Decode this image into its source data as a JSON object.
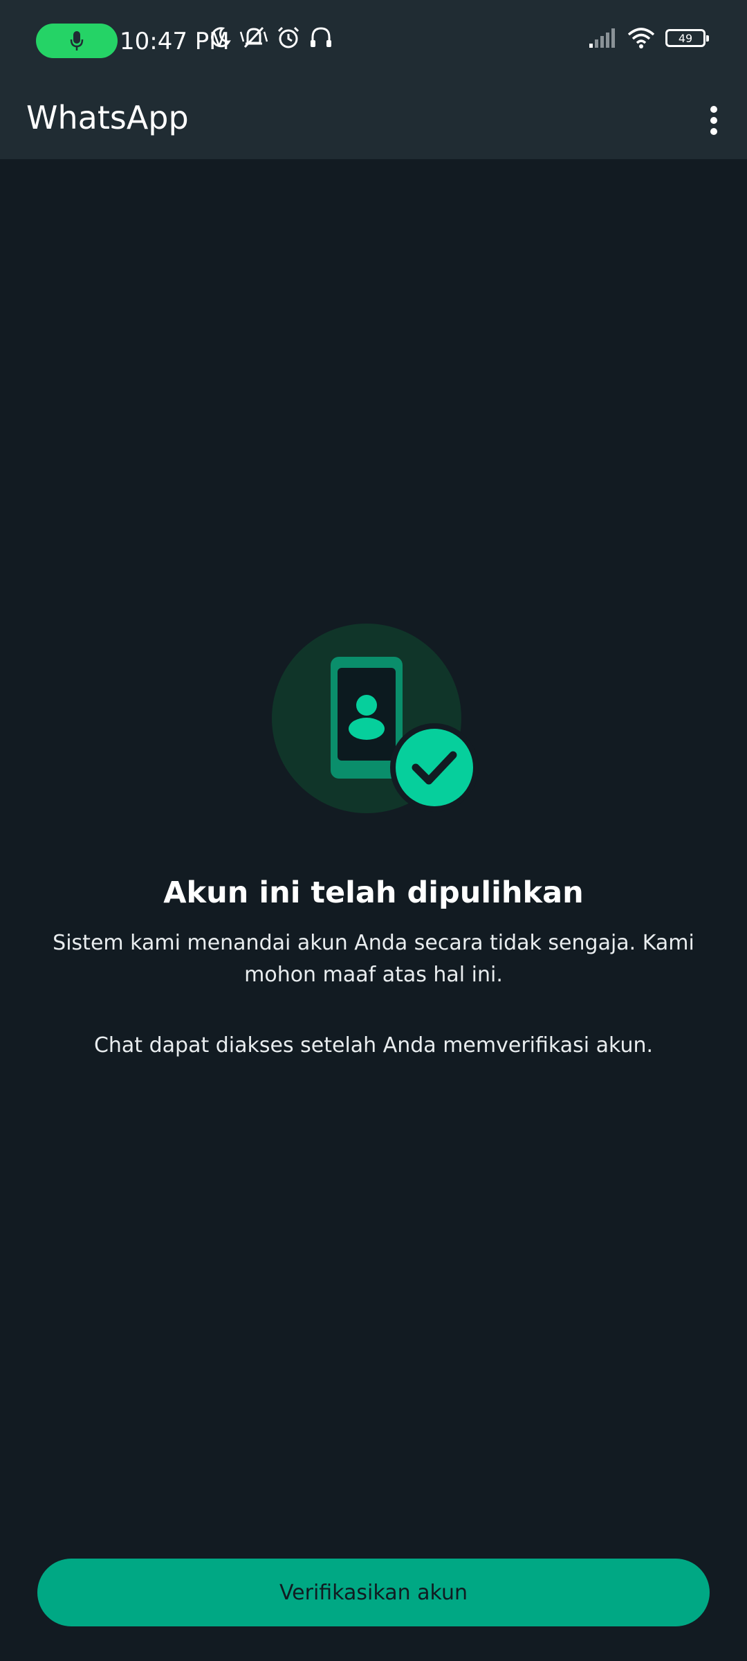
{
  "status_bar": {
    "time": "10:47 PM",
    "battery_level": "49",
    "icons": [
      "microphone-icon",
      "moon-icon",
      "mute-icon",
      "alarm-icon",
      "headphones-icon",
      "signal-icon",
      "wifi-icon",
      "battery-icon"
    ]
  },
  "app_bar": {
    "title": "WhatsApp",
    "menu_icon": "more-vertical-icon"
  },
  "content": {
    "illustration": "phone-check-icon",
    "headline": "Akun ini telah dipulihkan",
    "description": "Sistem kami menandai akun Anda secara tidak sengaja. Kami mohon maaf atas hal ini.",
    "secondary": "Chat dapat diakses setelah Anda memverifikasi akun."
  },
  "primary_button": {
    "label": "Verifikasikan akun"
  },
  "colors": {
    "background": "#121b22",
    "bar": "#202c33",
    "accent": "#00a884",
    "check": "#06cf9c",
    "illustration_circle": "#103529"
  }
}
